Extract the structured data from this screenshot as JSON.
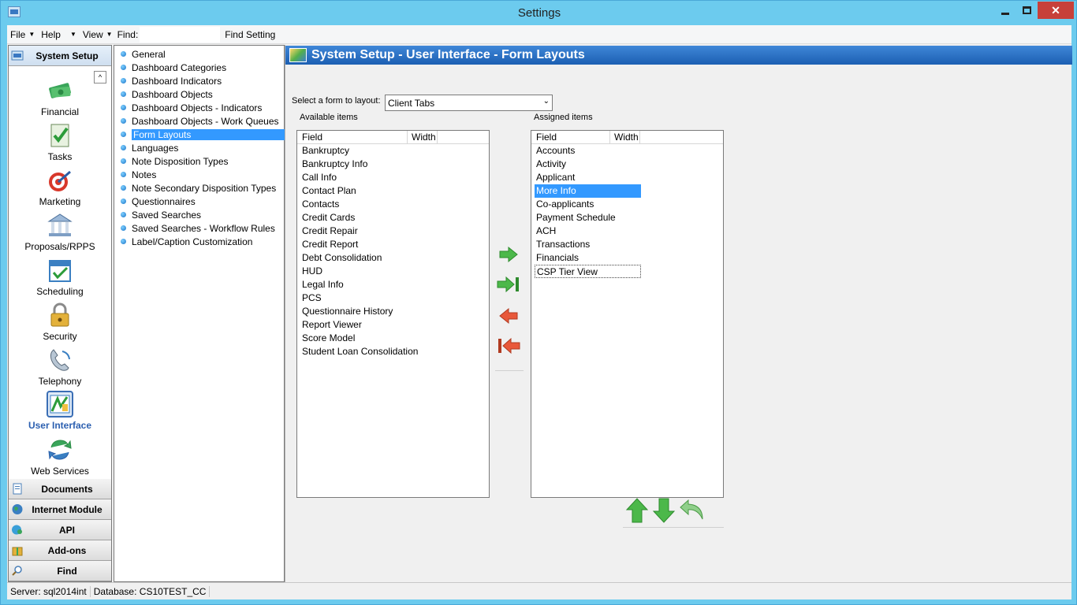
{
  "window": {
    "title": "Settings"
  },
  "menubar": {
    "items": [
      "File",
      "Help",
      "View"
    ],
    "find_label": "Find:",
    "find_value": "",
    "find_button": "Find Setting"
  },
  "nav": {
    "active_section": "System Setup",
    "items": [
      {
        "label": "Financial",
        "icon": "money-icon"
      },
      {
        "label": "Tasks",
        "icon": "checklist-icon"
      },
      {
        "label": "Marketing",
        "icon": "target-icon"
      },
      {
        "label": "Proposals/RPPS",
        "icon": "bank-icon"
      },
      {
        "label": "Scheduling",
        "icon": "calendar-icon"
      },
      {
        "label": "Security",
        "icon": "lock-icon"
      },
      {
        "label": "Telephony",
        "icon": "phone-icon"
      },
      {
        "label": "User Interface",
        "icon": "ui-icon"
      },
      {
        "label": "Web Services",
        "icon": "sync-icon"
      }
    ],
    "sections": [
      "Documents",
      "Internet Module",
      "API",
      "Add-ons",
      "Find"
    ]
  },
  "tree": {
    "items": [
      "General",
      "Dashboard Categories",
      "Dashboard Indicators",
      "Dashboard Objects",
      "Dashboard Objects - Indicators",
      "Dashboard Objects - Work Queues",
      "Form Layouts",
      "Languages",
      "Note Disposition Types",
      "Notes",
      "Note Secondary Disposition Types",
      "Questionnaires",
      "Saved Searches",
      "Saved Searches - Workflow Rules",
      "Label/Caption Customization"
    ],
    "selected": "Form Layouts"
  },
  "main": {
    "banner": "System Setup - User Interface - Form Layouts",
    "select_label": "Select a form to layout:",
    "select_value": "Client Tabs",
    "available_label": "Available items",
    "assigned_label": "Assigned items",
    "col_field": "Field",
    "col_width": "Width",
    "available": [
      "Bankruptcy",
      "Bankruptcy Info",
      "Call Info",
      "Contact Plan",
      "Contacts",
      "Credit Cards",
      "Credit Repair",
      "Credit Report",
      "Debt Consolidation",
      "HUD",
      "Legal Info",
      "PCS",
      "Questionnaire History",
      "Report Viewer",
      "Score Model",
      "Student Loan Consolidation"
    ],
    "assigned": [
      "Accounts",
      "Activity",
      "Applicant",
      "More Info",
      "Co-applicants",
      "Payment Schedule",
      "ACH",
      "Transactions",
      "Financials",
      "CSP Tier View"
    ],
    "assigned_selected": "More Info",
    "assigned_focused": "CSP Tier View"
  },
  "status": {
    "server": "Server: sql2014int",
    "database": "Database: CS10TEST_CC"
  },
  "colors": {
    "titlebar": "#6ccbee",
    "banner": "#1c5fb2",
    "selection": "#3399ff",
    "close": "#c7403a"
  }
}
